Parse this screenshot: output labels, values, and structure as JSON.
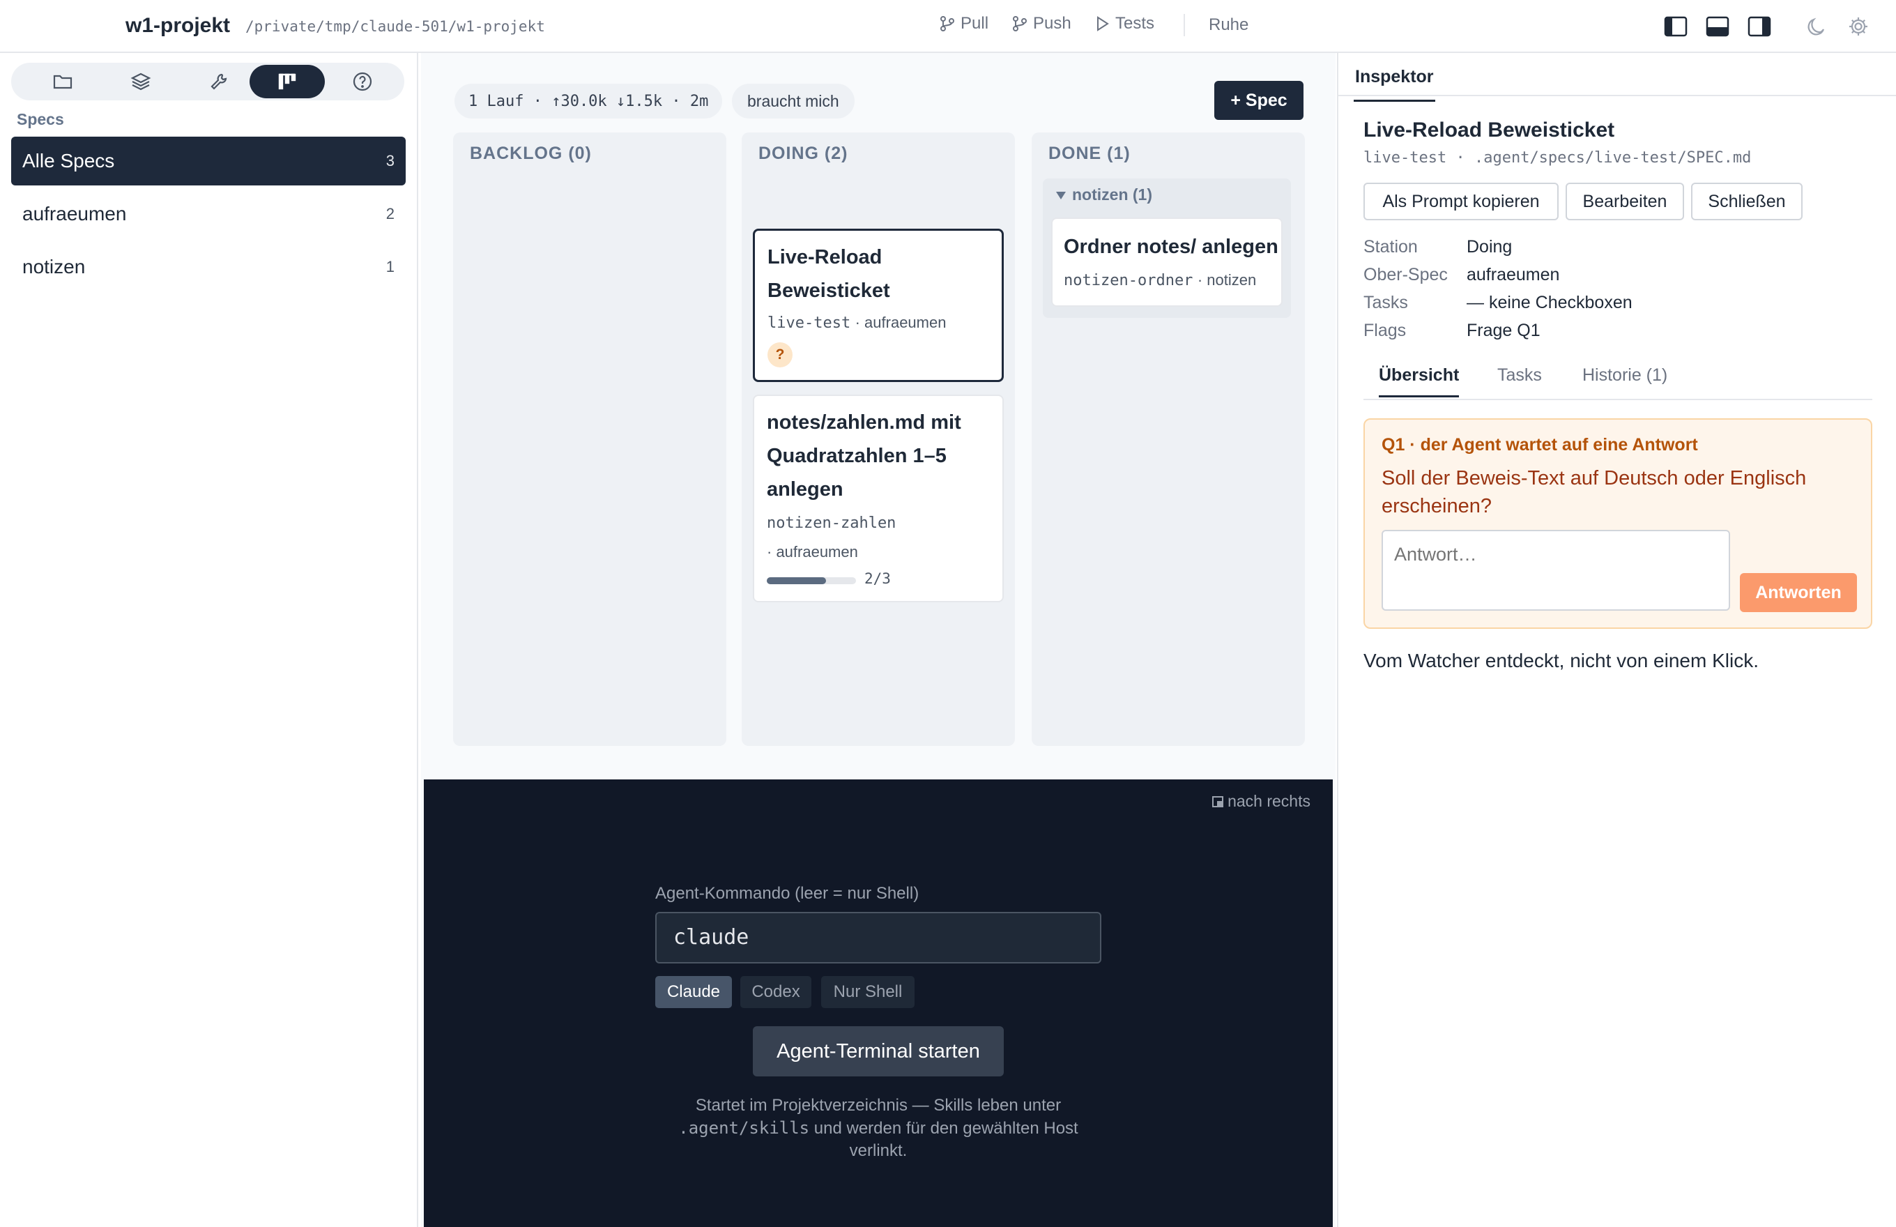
{
  "app": {
    "title": "w1-projekt",
    "path": "/private/tmp/claude-501/w1-projekt"
  },
  "toolbar": {
    "pull_label": "Pull",
    "push_label": "Push",
    "tests_label": "Tests",
    "status": "Ruhe",
    "icons": [
      "layout-left-panel-icon",
      "layout-bottom-panel-icon",
      "layout-right-panel-icon",
      "moon-icon",
      "gear-icon"
    ]
  },
  "sidebar": {
    "mode_tabs": [
      "folder-icon",
      "layers-icon",
      "wrench-icon",
      "kanban-icon",
      "help-icon"
    ],
    "active_mode": "kanban-icon",
    "heading": "Specs",
    "items": [
      {
        "label": "Alle Specs",
        "count": "3",
        "active": true
      },
      {
        "label": "aufraeumen",
        "count": "2",
        "active": false
      },
      {
        "label": "notizen",
        "count": "1",
        "active": false
      }
    ]
  },
  "board": {
    "run_stats": "1 Lauf · ↑30.0k ↓1.5k · 2m",
    "needs_me": "braucht mich",
    "add_spec": "+ Spec",
    "columns": [
      {
        "title": "BACKLOG (0)"
      },
      {
        "title": "DOING (2)"
      },
      {
        "title": "DONE (1)"
      }
    ],
    "cards": {
      "live_reload": {
        "title_line1": "Live-Reload",
        "title_line2": "Beweisticket",
        "slug": "live-test",
        "parent": "· aufraeumen",
        "badge": "?"
      },
      "zahlen": {
        "title_line1": "notes/zahlen.md mit",
        "title_line2": "Quadratzahlen 1–5",
        "title_line3": "anlegen",
        "slug": "notizen-zahlen",
        "parent": "· aufraeumen",
        "progress_text": "2/3",
        "progress": 0.667
      },
      "ordner": {
        "title": "Ordner notes/ anlegen",
        "slug": "notizen-ordner",
        "parent": "· notizen"
      }
    },
    "done_group": "notizen (1)"
  },
  "terminal": {
    "dock_label": "nach rechts",
    "agent_label": "Agent-Kommando (leer = nur Shell)",
    "agent_value": "claude",
    "hosts": [
      {
        "label": "Claude",
        "active": true
      },
      {
        "label": "Codex",
        "active": false
      },
      {
        "label": "Nur Shell",
        "active": false
      }
    ],
    "start_label": "Agent-Terminal starten",
    "hint_part1": "Startet im Projektverzeichnis — Skills leben unter",
    "hint_code": ".agent/skills",
    "hint_part2": " und werden für den gewählten Host",
    "hint_part3": "verlinkt."
  },
  "inspector": {
    "tab": "Inspektor",
    "title": "Live-Reload Beweisticket",
    "slug": "live-test",
    "sep": " · ",
    "path": ".agent/specs/live-test/SPEC.md",
    "buttons": {
      "copy": "Als Prompt kopieren",
      "edit": "Bearbeiten",
      "close": "Schließen"
    },
    "fields": [
      {
        "key": "Station",
        "value": "Doing"
      },
      {
        "key": "Ober-Spec",
        "value": "aufraeumen"
      },
      {
        "key": "Tasks",
        "value": "— keine Checkboxen"
      },
      {
        "key": "Flags",
        "value": "Frage Q1"
      }
    ],
    "subtabs": [
      "Übersicht",
      "Tasks",
      "Historie (1)"
    ],
    "question": {
      "title": "Q1 · der Agent wartet auf eine Antwort",
      "text": "Soll der Beweis-Text auf Deutsch oder Englisch erscheinen?",
      "placeholder": "Antwort…",
      "button": "Antworten"
    },
    "note": "Vom Watcher entdeckt, nicht von einem Klick."
  },
  "colors": {
    "accent_dark": "#1e293b",
    "terminal_bg": "#111827",
    "question_bg": "#fef5eb",
    "question_text": "#b45309",
    "answer_button": "#fb9a6c"
  }
}
